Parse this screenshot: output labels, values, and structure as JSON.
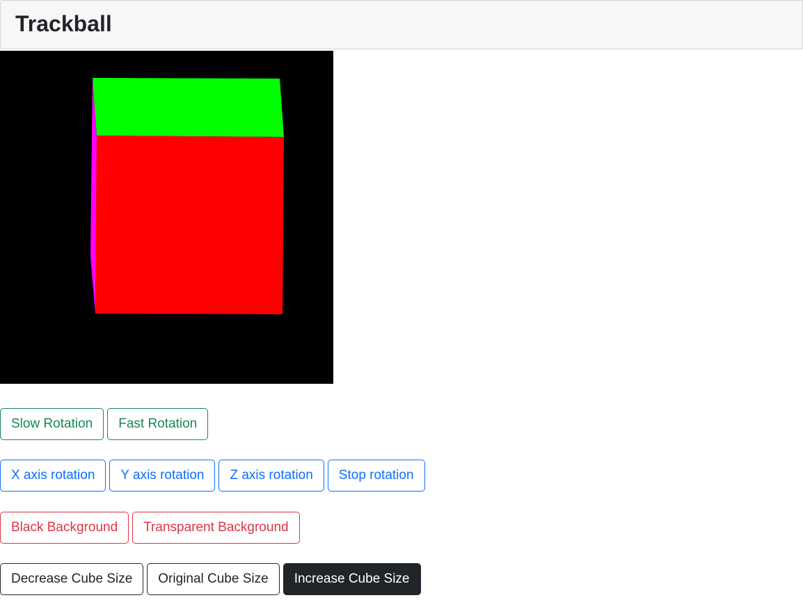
{
  "header": {
    "title": "Trackball"
  },
  "scene": {
    "background": "#000000",
    "faces": {
      "top": "#00ff00",
      "front": "#ff0000",
      "left": "#ff00ff"
    }
  },
  "rotation_speed": {
    "slow_label": "Slow Rotation",
    "fast_label": "Fast Rotation",
    "color": "#198754"
  },
  "rotation_axis": {
    "x_label": "X axis rotation",
    "y_label": "Y axis rotation",
    "z_label": "Z axis rotation",
    "stop_label": "Stop rotation",
    "color": "#0d6efd"
  },
  "background_controls": {
    "black_label": "Black Background",
    "transparent_label": "Transparent Background",
    "color": "#dc3545"
  },
  "cube_size": {
    "decrease_label": "Decrease Cube Size",
    "original_label": "Original Cube Size",
    "increase_label": "Increase Cube Size",
    "active": "increase",
    "color": "#212529"
  }
}
